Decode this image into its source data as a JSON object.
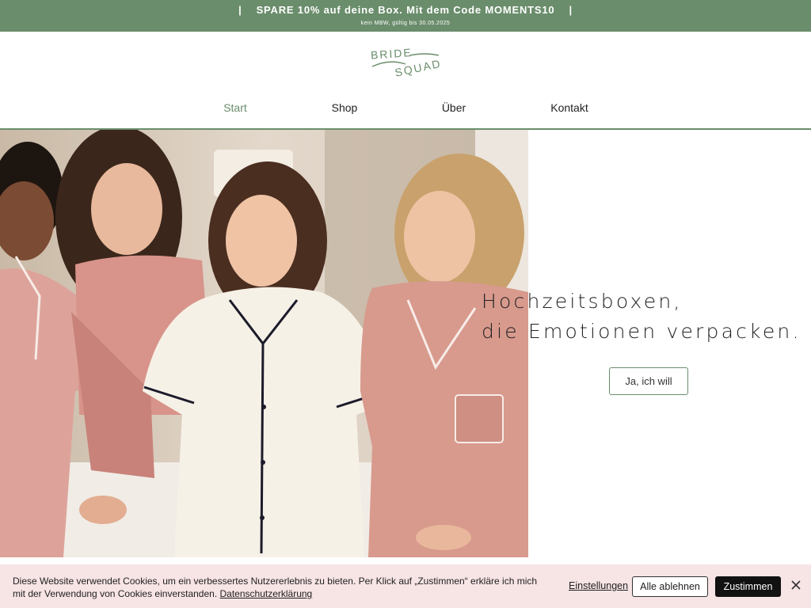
{
  "announcement": {
    "separator": "|",
    "text": "SPARE 10% auf deine Box. Mit dem Code MOMENTS10",
    "subtext": "kein MBW, gültig bis 30.05.2025"
  },
  "logo": {
    "line1": "BRIDE",
    "line2": "SQUAD",
    "icon": "bride-squad-logo"
  },
  "nav": {
    "items": [
      {
        "label": "Start",
        "active": true
      },
      {
        "label": "Shop"
      },
      {
        "label": "Über"
      },
      {
        "label": "Kontakt"
      }
    ]
  },
  "hero": {
    "image_icon": "bridesmaids-photo",
    "headline_line1": "Hochzeitsboxen,",
    "headline_line2": "die Emotionen verpacken.",
    "cta_label": "Ja, ich will"
  },
  "cookie": {
    "text": "Diese Website verwendet Cookies, um ein verbessertes Nutzererlebnis zu bieten. Per Klick auf „Zustimmen“ erkläre ich mich mit der Verwendung von Cookies einverstanden.",
    "privacy_link": "Datenschutzerklärung",
    "settings_label": "Einstellungen",
    "decline_label": "Alle ablehnen",
    "accept_label": "Zustimmen",
    "close_icon": "close-icon"
  },
  "colors": {
    "brand_green": "#6a8d6b",
    "cookie_bg": "#f7e4e5",
    "accept_bg": "#111111"
  }
}
